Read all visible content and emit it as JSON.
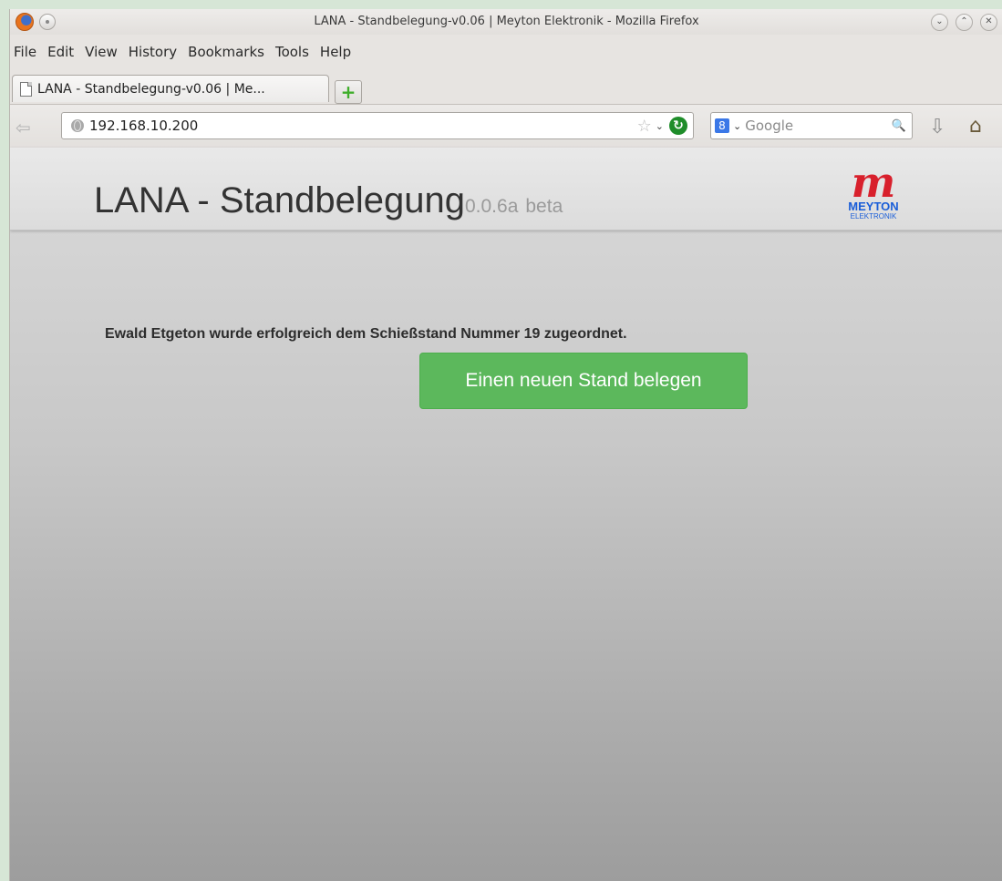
{
  "window": {
    "title": "LANA - Standbelegung-v0.06 | Meyton Elektronik - Mozilla Firefox",
    "controls": {
      "minimize": "⌄",
      "maximize": "⌃",
      "close": "✕"
    }
  },
  "menu": {
    "items": [
      {
        "label": "File",
        "key": "F"
      },
      {
        "label": "Edit",
        "key": "E"
      },
      {
        "label": "View",
        "key": "V"
      },
      {
        "label": "History",
        "key": "s"
      },
      {
        "label": "Bookmarks",
        "key": "B"
      },
      {
        "label": "Tools",
        "key": "T"
      },
      {
        "label": "Help",
        "key": "H"
      }
    ]
  },
  "tabs": [
    {
      "label": "LANA - Standbelegung-v0.06 | Me...",
      "active": true
    }
  ],
  "newtab_label": "+",
  "navbar": {
    "back_glyph": "⇦",
    "url": "192.168.10.200",
    "star_glyph": "☆",
    "dropdown_glyph": "⌄",
    "reload_glyph": "↻",
    "search_engine_glyph": "8",
    "search_dropdown_glyph": "⌄",
    "search_placeholder": "Google",
    "binoculars_glyph": "🔍",
    "download_glyph": "⇩",
    "home_glyph": "⌂"
  },
  "page": {
    "title": "LANA - Standbelegung",
    "version": "0.0.6a",
    "badge": "beta",
    "logo": {
      "letter": "m",
      "name": "MEYTON",
      "sub": "ELEKTRONIK"
    },
    "message": "Ewald Etgeton wurde erfolgreich dem Schießstand Nummer 19 zugeordnet.",
    "button_label": "Einen neuen Stand belegen"
  },
  "colors": {
    "button_bg": "#5cb85c",
    "logo_red": "#d8202c",
    "logo_blue": "#1a5ed8"
  }
}
